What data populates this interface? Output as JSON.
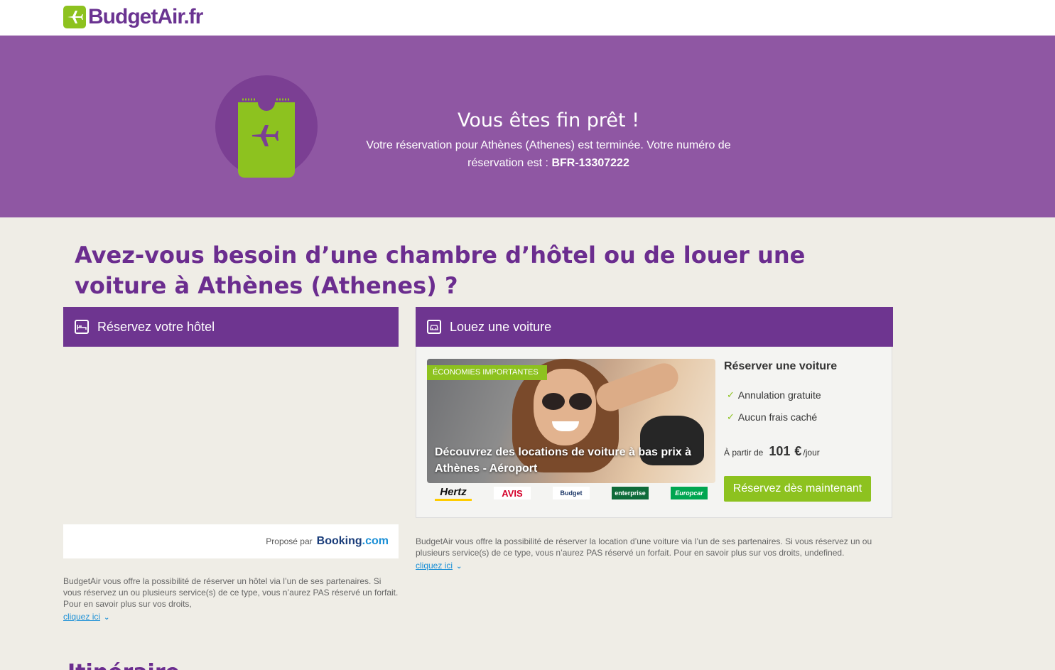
{
  "header": {
    "logo_text": "BudgetAir.fr",
    "brand_color": "#6a3391",
    "accent_color": "#8dc21f"
  },
  "hero": {
    "icon": "ticket-plane-icon",
    "title": "Vous êtes fin prêt !",
    "text_prefix": "Votre réservation pour Athènes (Athenes) est terminée. Votre numéro de réservation est : ",
    "booking_number": "BFR-13307222",
    "background_color": "#8f57a3"
  },
  "question": "Avez-vous besoin d’une chambre d’hôtel ou de louer une voiture à Athènes (Athenes) ?",
  "hotel": {
    "header": "Réservez votre hôtel",
    "icon": "bed-icon",
    "provided_by": "Proposé par",
    "provider_brand": "Booking",
    "provider_suffix": ".com",
    "disclaimer": "BudgetAir vous offre la possibilité de réserver un hôtel via l’un de ses partenaires. Si vous réservez un ou plusieurs service(s) de ce type, vous n’aurez PAS réservé un forfait. Pour en savoir plus sur vos droits,",
    "link": "cliquez ici"
  },
  "car": {
    "header": "Louez une voiture",
    "icon": "car-icon",
    "badge": "Économies importantes",
    "caption": "Découvrez des locations de voiture à bas prix à Athènes - Aéroport",
    "partners": [
      "Hertz",
      "AVIS",
      "Budget",
      "enterprise",
      "Europcar"
    ],
    "side_title": "Réserver une voiture",
    "features": [
      "Annulation gratuite",
      "Aucun frais caché"
    ],
    "price_prefix": "À partir de",
    "price_amount": "101",
    "price_currency": "€",
    "price_unit": "/jour",
    "cta": "Réservez dès maintenant",
    "disclaimer": "BudgetAir vous offre la possibilité de réserver la location d’une voiture via l’un de ses partenaires. Si vous réservez un ou plusieurs service(s) de ce type, vous n’aurez PAS réservé un forfait. Pour en savoir plus sur vos droits, undefined.",
    "link": "cliquez ici"
  },
  "next_section_peek": "Itinéraire réservé"
}
